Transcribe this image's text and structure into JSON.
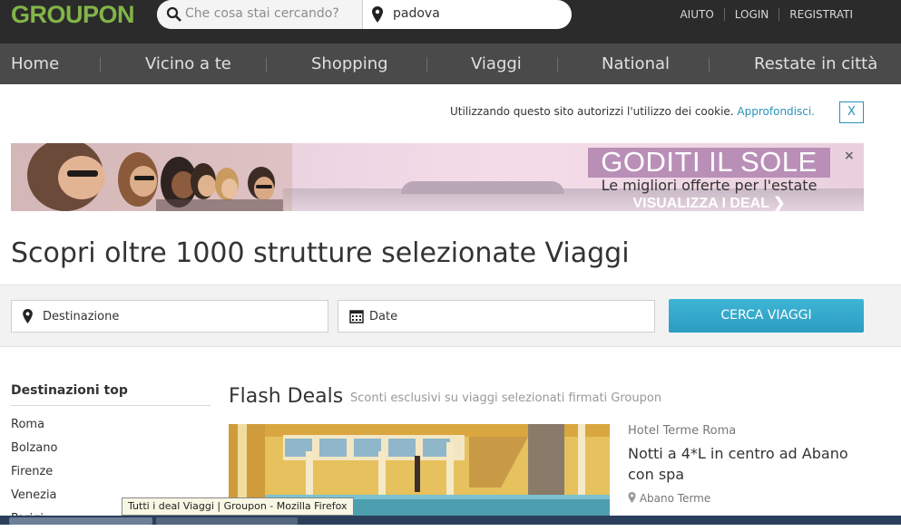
{
  "brand": {
    "logo": "GROUPON",
    "color": "#82b548"
  },
  "search": {
    "query_placeholder": "Che cosa stai cercando?",
    "location_value": "padova"
  },
  "top_links": [
    "AIUTO",
    "LOGIN",
    "REGISTRATI"
  ],
  "nav": [
    "Home",
    "Vicino a te",
    "Shopping",
    "Viaggi",
    "National",
    "Restate in città"
  ],
  "cookie": {
    "text": "Utilizzando questo sito autorizzi l'utilizzo dei cookie. ",
    "link": "Approfondisci.",
    "close": "X"
  },
  "banner": {
    "headline": "GODITI IL SOLE",
    "subline": "Le migliori offerte per l'estate",
    "cta": "VISUALIZZA I DEAL ❯",
    "close": "×"
  },
  "page_title": "Scopri oltre 1000 strutture selezionate Viaggi",
  "travel_search": {
    "destination_label": "Destinazione",
    "date_label": "Date",
    "button": "CERCA VIAGGI"
  },
  "sidebar": {
    "title": "Destinazioni top",
    "items": [
      "Roma",
      "Bolzano",
      "Firenze",
      "Venezia",
      "Parigi"
    ]
  },
  "flash": {
    "title": "Flash Deals",
    "subtitle": "Sconti esclusivi su viaggi selezionati firmati Groupon"
  },
  "deal": {
    "vendor": "Hotel Terme Roma",
    "title": "Notti a 4*L in centro ad Abano con spa",
    "location": "Abano Terme"
  },
  "tooltip": "Tutti i deal Viaggi | Groupon - Mozilla Firefox",
  "colors": {
    "accent": "#2a93b9",
    "topbar": "#2b2b2b",
    "navbar": "#4a4a4a",
    "button": "#3eb5d6"
  }
}
